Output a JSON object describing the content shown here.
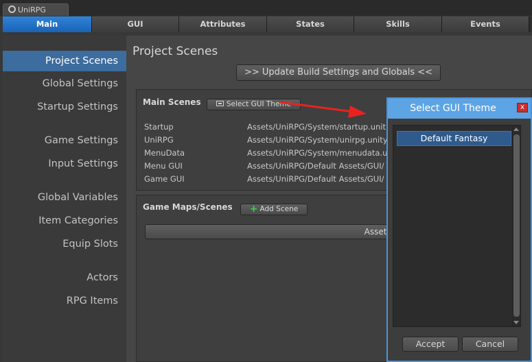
{
  "window": {
    "tab_title": "UniRPG"
  },
  "toolbar": {
    "tabs": [
      {
        "label": "Main"
      },
      {
        "label": "GUI"
      },
      {
        "label": "Attributes"
      },
      {
        "label": "States"
      },
      {
        "label": "Skills"
      },
      {
        "label": "Events"
      }
    ]
  },
  "sidebar": {
    "items": [
      {
        "label": "Project Scenes"
      },
      {
        "label": "Global Settings"
      },
      {
        "label": "Startup Settings"
      },
      {
        "label": "Game Settings"
      },
      {
        "label": "Input Settings"
      },
      {
        "label": "Global Variables"
      },
      {
        "label": "Item Categories"
      },
      {
        "label": "Equip Slots"
      },
      {
        "label": "Actors"
      },
      {
        "label": "RPG Items"
      }
    ]
  },
  "main": {
    "title": "Project Scenes",
    "update_button": ">> Update Build Settings and Globals <<",
    "main_scenes": {
      "title": "Main Scenes",
      "select_theme_button": "Select GUI Theme",
      "rows": [
        {
          "name": "Startup",
          "path": "Assets/UniRPG/System/startup.unit"
        },
        {
          "name": "UniRPG",
          "path": "Assets/UniRPG/System/unirpg.unity"
        },
        {
          "name": "MenuData",
          "path": "Assets/UniRPG/System/menudata.u"
        },
        {
          "name": "Menu GUI",
          "path": "Assets/UniRPG/Default Assets/GUI/"
        },
        {
          "name": "Game GUI",
          "path": "Assets/UniRPG/Default Assets/GUI/"
        }
      ]
    },
    "game_maps": {
      "title": "Game Maps/Scenes",
      "add_scene_button": "Add Scene",
      "scenes": [
        {
          "path": "Assets/UniRPG Data/Scenes/gamescene"
        }
      ]
    }
  },
  "dialog": {
    "title": "Select GUI Theme",
    "close_label": "x",
    "themes": [
      {
        "label": "Default Fantasy",
        "selected": true
      }
    ],
    "accept_button": "Accept",
    "cancel_button": "Cancel"
  },
  "colors": {
    "active_tab": "#1e6cc0",
    "sidebar_selected": "#3d6c9e",
    "dialog_titlebar": "#5da4e4",
    "close_button": "#c8302d",
    "arrow": "#e8231f",
    "add_icon": "#3fcf4a"
  }
}
